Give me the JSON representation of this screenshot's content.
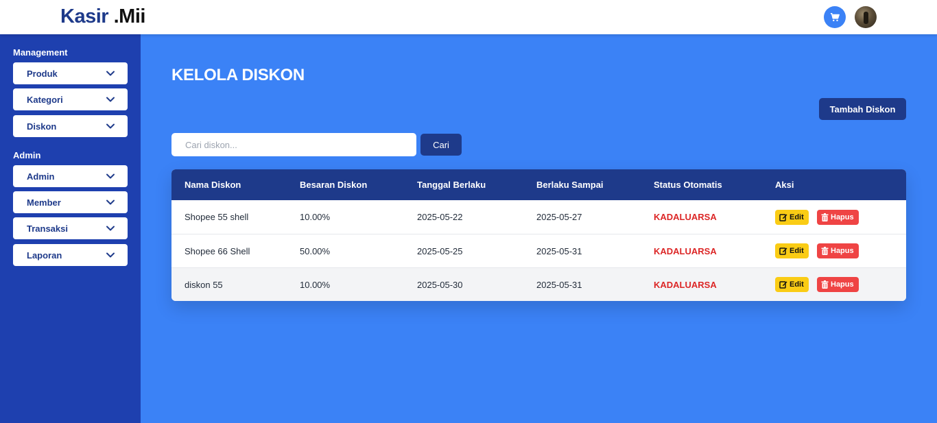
{
  "header": {
    "brand_primary": "Kasir",
    "brand_secondary": " .Mii",
    "cart_icon": "cart-icon",
    "avatar_icon": "user-avatar"
  },
  "sidebar": {
    "management_title": "Management",
    "admin_title": "Admin",
    "management_items": [
      {
        "label": "Produk"
      },
      {
        "label": "Kategori"
      },
      {
        "label": "Diskon"
      }
    ],
    "admin_items": [
      {
        "label": "Admin"
      },
      {
        "label": "Member"
      },
      {
        "label": "Transaksi"
      },
      {
        "label": "Laporan"
      }
    ]
  },
  "main": {
    "title": "KELOLA DISKON",
    "add_button": "Tambah Diskon",
    "search": {
      "placeholder": "Cari diskon...",
      "value": "",
      "button": "Cari"
    },
    "table": {
      "headers": [
        "Nama Diskon",
        "Besaran Diskon",
        "Tanggal Berlaku",
        "Berlaku Sampai",
        "Status Otomatis",
        "Aksi"
      ],
      "rows": [
        {
          "name": "Shopee 55 shell",
          "amount": "10.00%",
          "start": "2025-05-22",
          "end": "2025-05-27",
          "status": "KADALUARSA"
        },
        {
          "name": "Shopee 66 Shell",
          "amount": "50.00%",
          "start": "2025-05-25",
          "end": "2025-05-31",
          "status": "KADALUARSA"
        },
        {
          "name": "diskon 55",
          "amount": "10.00%",
          "start": "2025-05-30",
          "end": "2025-05-31",
          "status": "KADALUARSA"
        }
      ],
      "edit_label": "Edit",
      "delete_label": "Hapus"
    }
  },
  "colors": {
    "background": "#3b82f6",
    "sidebar": "#1e40af",
    "primary_dark": "#1e3a8a",
    "edit": "#facc15",
    "delete": "#ef4444",
    "expired": "#dc2626"
  }
}
